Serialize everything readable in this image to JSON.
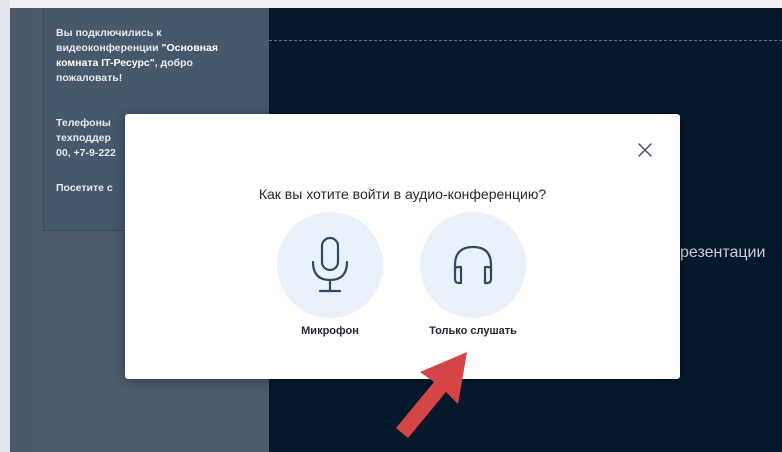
{
  "chat": {
    "welcome_prefix": "Вы подключились к видеоконференции",
    "room_name": "\"Основная комната IT-Ресурс\"",
    "welcome_suffix": ", добро пожаловать!",
    "support_line1": "Телефоны",
    "support_line2": "техподдер",
    "support_line3": "00, +7-9-222",
    "visit_text": "Посетите с"
  },
  "presentation": {
    "text": "резентации"
  },
  "dialog": {
    "question": "Как вы хотите войти в аудио-конференцию?",
    "close_icon": "close-icon",
    "options": [
      {
        "label": "Микрофон",
        "icon": "microphone-icon"
      },
      {
        "label": "Только слушать",
        "icon": "headphones-icon"
      }
    ]
  },
  "colors": {
    "accent_arrow": "#d64545",
    "option_circle": "#e9f2fb",
    "main_bg": "#06182b"
  }
}
